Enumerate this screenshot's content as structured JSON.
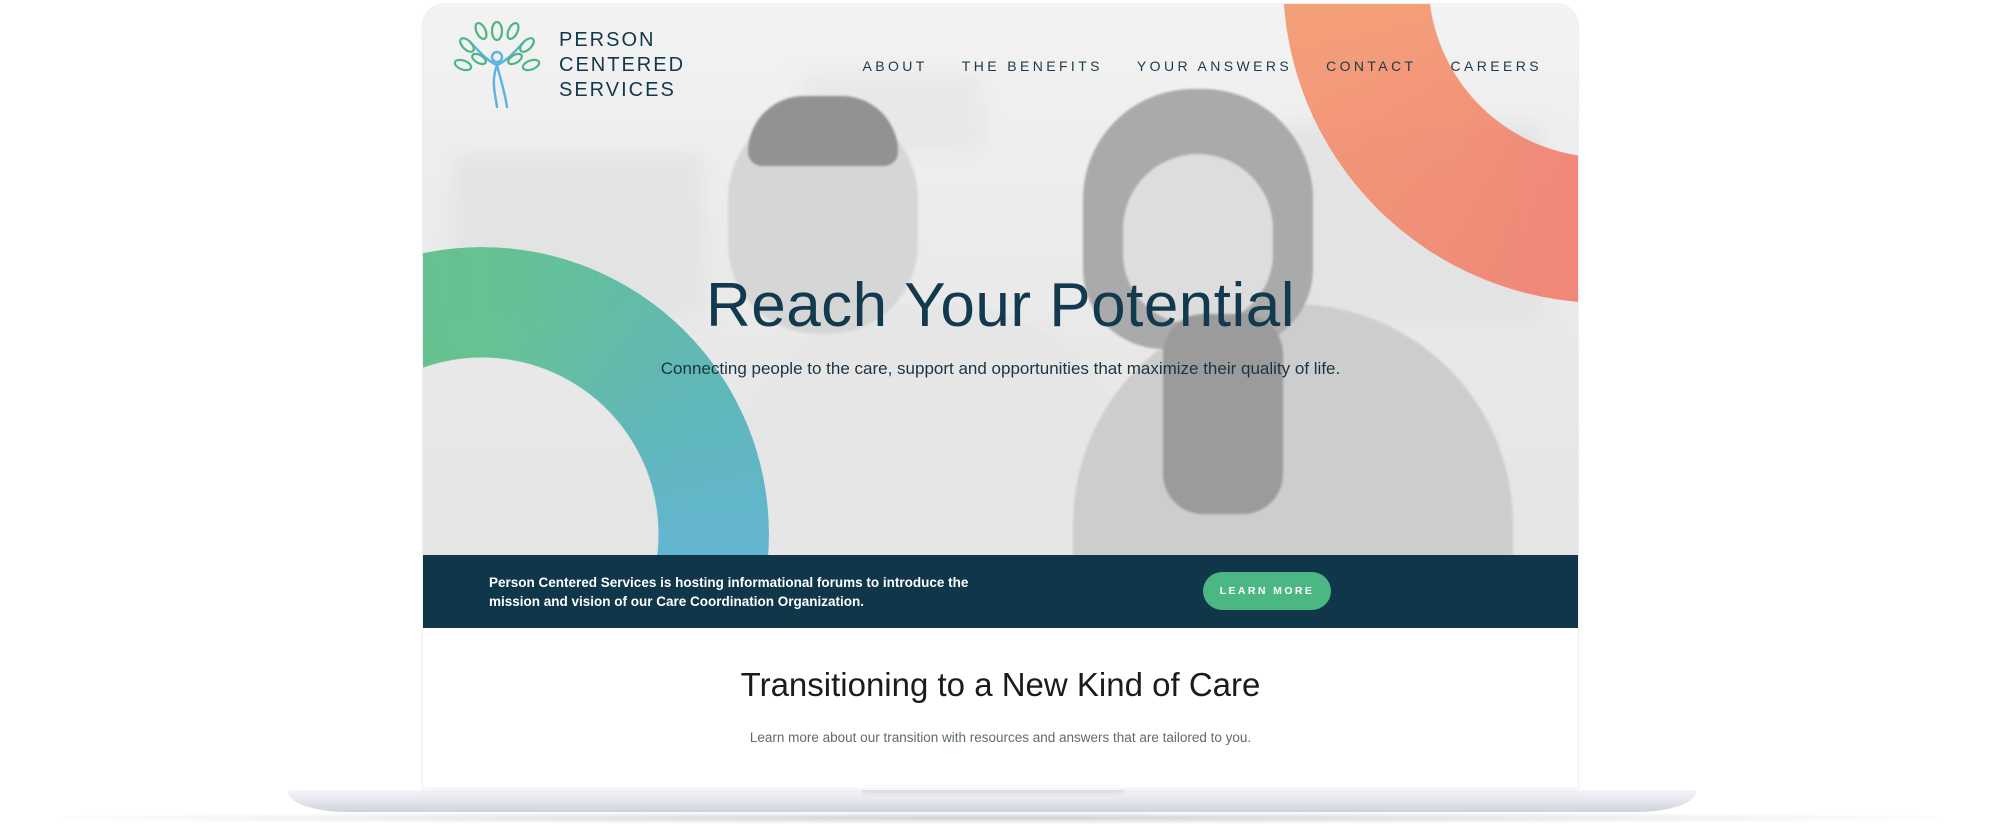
{
  "logo": {
    "line1": "PERSON",
    "line2": "CENTERED",
    "line3": "SERVICES",
    "icon": "tree-person-icon"
  },
  "nav": {
    "items": [
      "ABOUT",
      "THE BENEFITS",
      "YOUR ANSWERS",
      "CONTACT",
      "CAREERS"
    ]
  },
  "hero": {
    "title": "Reach Your Potential",
    "subtitle": "Connecting people to the care, support and opportunities that maximize their quality of life."
  },
  "banner": {
    "text": "Person Centered Services is hosting informational forums to introduce the mission and vision of our Care Coordination Organization.",
    "button_label": "LEARN MORE"
  },
  "section": {
    "title": "Transitioning to a New Kind of Care",
    "subtitle": "Learn more about our transition with resources and answers that are tailored to you."
  },
  "colors": {
    "navy": "#0f3649",
    "green": "#4bb783",
    "blue": "#5bb3e2",
    "orange": "#f39a6f",
    "peach": "#f6bb77"
  }
}
